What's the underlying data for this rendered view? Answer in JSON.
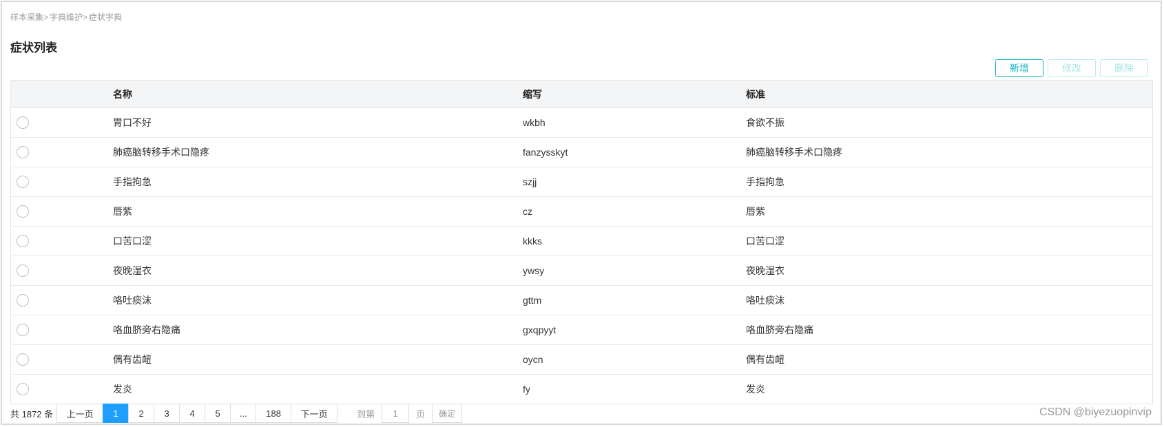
{
  "breadcrumb": [
    "样本采集>",
    "字典维护>",
    "症状字典"
  ],
  "title": "症状列表",
  "toolbar": {
    "add": "新增",
    "edit": "修改",
    "delete": "删除",
    "accent_color": "#19b6c2"
  },
  "table": {
    "headers": {
      "name": "名称",
      "abbr": "缩写",
      "standard": "标准"
    },
    "rows": [
      {
        "name": "胃口不好",
        "abbr": "wkbh",
        "standard": "食欲不振"
      },
      {
        "name": "肺癌脑转移手术口隐疼",
        "abbr": "fanzysskyt",
        "standard": "肺癌脑转移手术口隐疼"
      },
      {
        "name": "手指拘急",
        "abbr": "szjj",
        "standard": "手指拘急"
      },
      {
        "name": "唇紫",
        "abbr": "cz",
        "standard": "唇紫"
      },
      {
        "name": "口苦口涩",
        "abbr": "kkks",
        "standard": "口苦口涩"
      },
      {
        "name": "夜晚湿衣",
        "abbr": "ywsy",
        "standard": "夜晚湿衣"
      },
      {
        "name": "咯吐痰沫",
        "abbr": "gttm",
        "standard": "咯吐痰沫"
      },
      {
        "name": "咯血脐旁右隐痛",
        "abbr": "gxqpyyt",
        "standard": "咯血脐旁右隐痛"
      },
      {
        "name": "偶有齿衄",
        "abbr": "oycn",
        "standard": "偶有齿衄"
      },
      {
        "name": "发炎",
        "abbr": "fy",
        "standard": "发炎"
      }
    ]
  },
  "pagination": {
    "total": "共 1872 条",
    "prev": "上一页",
    "pages": [
      "1",
      "2",
      "3",
      "4",
      "5",
      "...",
      "188"
    ],
    "current": "1",
    "next": "下一页",
    "goto_prefix": "到第",
    "goto_value": "1",
    "goto_suffix": "页",
    "confirm": "确定",
    "active_color": "#1e9fff"
  },
  "watermark": "CSDN @biyezuopinvip"
}
